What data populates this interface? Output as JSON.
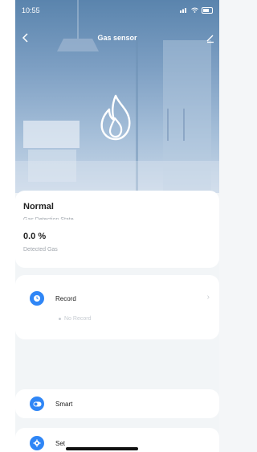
{
  "status_bar": {
    "time": "10:55"
  },
  "nav": {
    "title": "Gas sensor"
  },
  "detection": {
    "value": "Normal",
    "label": "Gas Detection State"
  },
  "gas": {
    "value": "0.0 %",
    "label": "Detected Gas"
  },
  "record": {
    "label": "Record",
    "empty_text": "No Record"
  },
  "smart": {
    "label": "Smart"
  },
  "set": {
    "label": "Set"
  },
  "colors": {
    "accent": "#2f86f6",
    "hero_top": "#5a84ad",
    "hero_bottom": "#c9d8e8"
  },
  "icons": [
    "back-arrow-icon",
    "edit-icon",
    "flame-icon",
    "clock-icon",
    "toggle-icon",
    "gear-icon",
    "chevron-right-icon"
  ]
}
